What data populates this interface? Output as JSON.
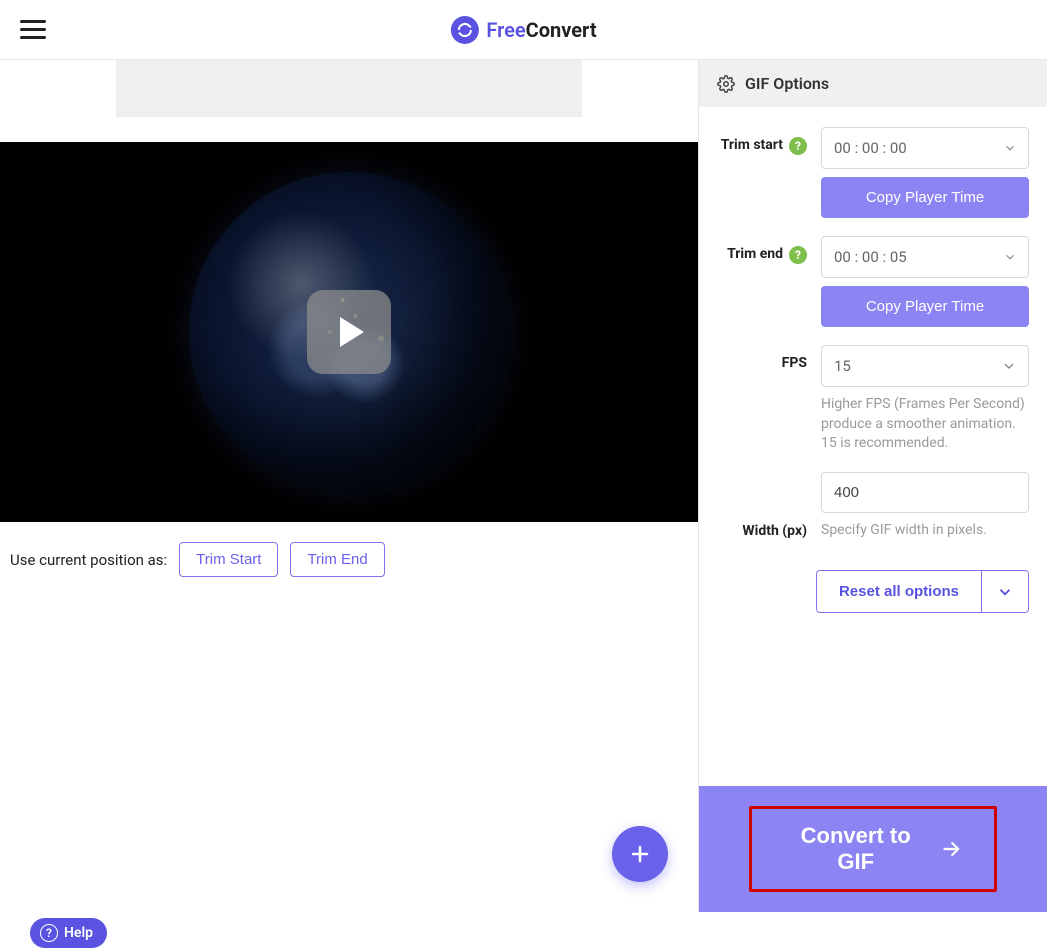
{
  "header": {
    "logo_free": "Free",
    "logo_convert": "Convert"
  },
  "video": {
    "position_label": "Use current position as:",
    "trim_start_btn": "Trim Start",
    "trim_end_btn": "Trim End"
  },
  "help": {
    "label": "Help"
  },
  "options": {
    "title": "GIF Options",
    "trim_start": {
      "label": "Trim start",
      "value": "00 : 00 : 00",
      "copy_btn": "Copy Player Time"
    },
    "trim_end": {
      "label": "Trim end",
      "value": "00 : 00 : 05",
      "copy_btn": "Copy Player Time"
    },
    "fps": {
      "label": "FPS",
      "value": "15",
      "hint": "Higher FPS (Frames Per Second) produce a smoother animation. 15 is recommended."
    },
    "width": {
      "label": "Width (px)",
      "value": "400",
      "hint": "Specify GIF width in pixels."
    },
    "reset_btn": "Reset all options",
    "convert_btn": "Convert to GIF"
  }
}
